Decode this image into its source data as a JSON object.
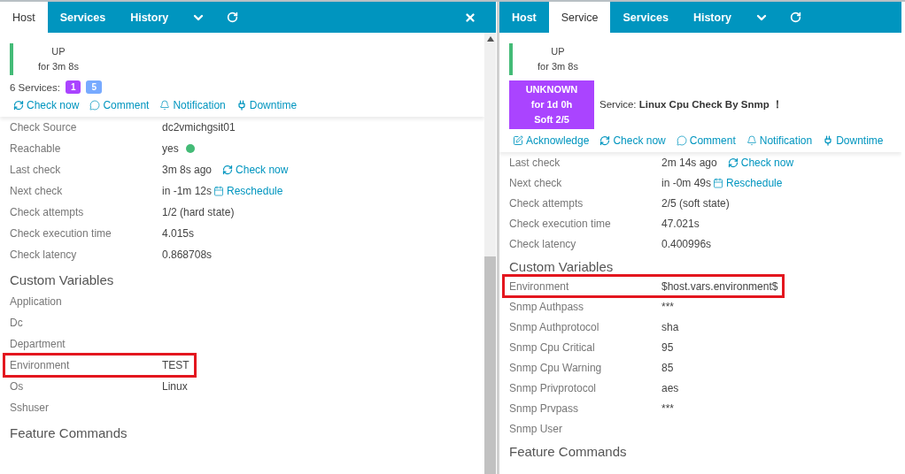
{
  "panels": [
    {
      "closable": true,
      "tabs": [
        {
          "label": "Host",
          "selected": true
        },
        {
          "label": "Services",
          "selected": false
        },
        {
          "label": "History",
          "selected": false
        }
      ],
      "statuses": [
        {
          "kind": "host",
          "state": "UP",
          "since": "for 3m 8s",
          "color": "#44bb77"
        }
      ],
      "services": {
        "label": "6 Services:",
        "badges": [
          {
            "count": "1",
            "color": "#aa44ff"
          },
          {
            "count": "5",
            "color": "#77aaff"
          }
        ]
      },
      "actions": [
        {
          "kind": "refresh",
          "label": "Check now"
        },
        {
          "kind": "comment",
          "label": "Comment"
        },
        {
          "kind": "bell",
          "label": "Notification"
        },
        {
          "kind": "plug",
          "label": "Downtime"
        }
      ],
      "sections": [
        {
          "rows": [
            {
              "label": "Check Source",
              "value": "dc2vmichgsit01",
              "highlighted": false
            },
            {
              "label": "Reachable",
              "value": "yes",
              "online": true,
              "highlighted": false
            },
            {
              "label": "Last check",
              "value": "3m 8s ago",
              "link": {
                "kind": "refresh",
                "label": "Check now"
              },
              "highlighted": false
            },
            {
              "label": "Next check",
              "value": "in -1m 12s",
              "link": {
                "kind": "calendar",
                "label": "Reschedule"
              },
              "highlighted": false
            },
            {
              "label": "Check attempts",
              "value": "1/2 (hard state)",
              "highlighted": false
            },
            {
              "label": "Check execution time",
              "value": "4.015s",
              "highlighted": false
            },
            {
              "label": "Check latency",
              "value": "0.868708s",
              "highlighted": false
            }
          ]
        },
        {
          "heading": "Custom Variables",
          "rows": [
            {
              "label": "Application",
              "highlighted": false
            },
            {
              "label": "Dc",
              "highlighted": false
            },
            {
              "label": "Department",
              "highlighted": false
            },
            {
              "label": "Environment",
              "value": "TEST",
              "highlighted": true
            },
            {
              "label": "Os",
              "value": "Linux",
              "highlighted": false
            },
            {
              "label": "Sshuser",
              "highlighted": false
            }
          ]
        },
        {
          "heading": "Feature Commands"
        }
      ]
    },
    {
      "tabs": [
        {
          "label": "Host",
          "selected": false
        },
        {
          "label": "Service",
          "selected": true
        },
        {
          "label": "Services",
          "selected": false
        },
        {
          "label": "History",
          "selected": false
        }
      ],
      "statuses": [
        {
          "kind": "host",
          "state": "UP",
          "since": "for 3m 8s",
          "color": "#44bb77"
        },
        {
          "kind": "service",
          "state": "UNKNOWN",
          "since": "for 1d 0h",
          "attempt": "Soft 2/5",
          "color": "#aa44ff",
          "title": "Service: **Linux Cpu Check By Snmp ！**"
        }
      ],
      "actions": [
        {
          "kind": "ack",
          "label": "Acknowledge"
        },
        {
          "kind": "refresh",
          "label": "Check now"
        },
        {
          "kind": "comment",
          "label": "Comment"
        },
        {
          "kind": "bell",
          "label": "Notification"
        },
        {
          "kind": "plug",
          "label": "Downtime"
        }
      ],
      "sections": [
        {
          "rows": [
            {
              "label": "Last check",
              "value": "2m 14s ago",
              "link": {
                "kind": "refresh",
                "label": "Check now"
              },
              "highlighted": false
            },
            {
              "label": "Next check",
              "value": "in -0m 49s",
              "link": {
                "kind": "calendar",
                "label": "Reschedule"
              },
              "highlighted": false
            },
            {
              "label": "Check attempts",
              "value": "2/5 (soft state)",
              "highlighted": false
            },
            {
              "label": "Check execution time",
              "value": "47.021s",
              "highlighted": false
            },
            {
              "label": "Check latency",
              "value": "0.400996s",
              "highlighted": false
            }
          ]
        },
        {
          "heading": "Custom Variables",
          "rows": [
            {
              "label": "Environment",
              "value": "$host.vars.environment$",
              "highlighted": true
            },
            {
              "label": "Snmp Authpass",
              "value": "***",
              "highlighted": false
            },
            {
              "label": "Snmp Authprotocol",
              "value": "sha",
              "highlighted": false
            },
            {
              "label": "Snmp Cpu Critical",
              "value": "95",
              "highlighted": false
            },
            {
              "label": "Snmp Cpu Warning",
              "value": "85",
              "highlighted": false
            },
            {
              "label": "Snmp Privprotocol",
              "value": "aes",
              "highlighted": false
            },
            {
              "label": "Snmp Prvpass",
              "value": "***",
              "highlighted": false
            },
            {
              "label": "Snmp User",
              "highlighted": false
            }
          ]
        },
        {
          "heading": "Feature Commands"
        }
      ]
    }
  ]
}
